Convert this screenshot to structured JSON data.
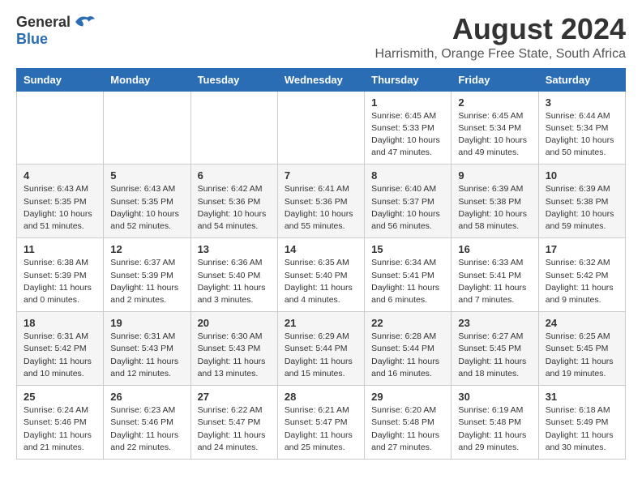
{
  "logo": {
    "general": "General",
    "blue": "Blue"
  },
  "title": "August 2024",
  "subtitle": "Harrismith, Orange Free State, South Africa",
  "days_of_week": [
    "Sunday",
    "Monday",
    "Tuesday",
    "Wednesday",
    "Thursday",
    "Friday",
    "Saturday"
  ],
  "weeks": [
    [
      {
        "day": "",
        "info": ""
      },
      {
        "day": "",
        "info": ""
      },
      {
        "day": "",
        "info": ""
      },
      {
        "day": "",
        "info": ""
      },
      {
        "day": "1",
        "info": "Sunrise: 6:45 AM\nSunset: 5:33 PM\nDaylight: 10 hours\nand 47 minutes."
      },
      {
        "day": "2",
        "info": "Sunrise: 6:45 AM\nSunset: 5:34 PM\nDaylight: 10 hours\nand 49 minutes."
      },
      {
        "day": "3",
        "info": "Sunrise: 6:44 AM\nSunset: 5:34 PM\nDaylight: 10 hours\nand 50 minutes."
      }
    ],
    [
      {
        "day": "4",
        "info": "Sunrise: 6:43 AM\nSunset: 5:35 PM\nDaylight: 10 hours\nand 51 minutes."
      },
      {
        "day": "5",
        "info": "Sunrise: 6:43 AM\nSunset: 5:35 PM\nDaylight: 10 hours\nand 52 minutes."
      },
      {
        "day": "6",
        "info": "Sunrise: 6:42 AM\nSunset: 5:36 PM\nDaylight: 10 hours\nand 54 minutes."
      },
      {
        "day": "7",
        "info": "Sunrise: 6:41 AM\nSunset: 5:36 PM\nDaylight: 10 hours\nand 55 minutes."
      },
      {
        "day": "8",
        "info": "Sunrise: 6:40 AM\nSunset: 5:37 PM\nDaylight: 10 hours\nand 56 minutes."
      },
      {
        "day": "9",
        "info": "Sunrise: 6:39 AM\nSunset: 5:38 PM\nDaylight: 10 hours\nand 58 minutes."
      },
      {
        "day": "10",
        "info": "Sunrise: 6:39 AM\nSunset: 5:38 PM\nDaylight: 10 hours\nand 59 minutes."
      }
    ],
    [
      {
        "day": "11",
        "info": "Sunrise: 6:38 AM\nSunset: 5:39 PM\nDaylight: 11 hours\nand 0 minutes."
      },
      {
        "day": "12",
        "info": "Sunrise: 6:37 AM\nSunset: 5:39 PM\nDaylight: 11 hours\nand 2 minutes."
      },
      {
        "day": "13",
        "info": "Sunrise: 6:36 AM\nSunset: 5:40 PM\nDaylight: 11 hours\nand 3 minutes."
      },
      {
        "day": "14",
        "info": "Sunrise: 6:35 AM\nSunset: 5:40 PM\nDaylight: 11 hours\nand 4 minutes."
      },
      {
        "day": "15",
        "info": "Sunrise: 6:34 AM\nSunset: 5:41 PM\nDaylight: 11 hours\nand 6 minutes."
      },
      {
        "day": "16",
        "info": "Sunrise: 6:33 AM\nSunset: 5:41 PM\nDaylight: 11 hours\nand 7 minutes."
      },
      {
        "day": "17",
        "info": "Sunrise: 6:32 AM\nSunset: 5:42 PM\nDaylight: 11 hours\nand 9 minutes."
      }
    ],
    [
      {
        "day": "18",
        "info": "Sunrise: 6:31 AM\nSunset: 5:42 PM\nDaylight: 11 hours\nand 10 minutes."
      },
      {
        "day": "19",
        "info": "Sunrise: 6:31 AM\nSunset: 5:43 PM\nDaylight: 11 hours\nand 12 minutes."
      },
      {
        "day": "20",
        "info": "Sunrise: 6:30 AM\nSunset: 5:43 PM\nDaylight: 11 hours\nand 13 minutes."
      },
      {
        "day": "21",
        "info": "Sunrise: 6:29 AM\nSunset: 5:44 PM\nDaylight: 11 hours\nand 15 minutes."
      },
      {
        "day": "22",
        "info": "Sunrise: 6:28 AM\nSunset: 5:44 PM\nDaylight: 11 hours\nand 16 minutes."
      },
      {
        "day": "23",
        "info": "Sunrise: 6:27 AM\nSunset: 5:45 PM\nDaylight: 11 hours\nand 18 minutes."
      },
      {
        "day": "24",
        "info": "Sunrise: 6:25 AM\nSunset: 5:45 PM\nDaylight: 11 hours\nand 19 minutes."
      }
    ],
    [
      {
        "day": "25",
        "info": "Sunrise: 6:24 AM\nSunset: 5:46 PM\nDaylight: 11 hours\nand 21 minutes."
      },
      {
        "day": "26",
        "info": "Sunrise: 6:23 AM\nSunset: 5:46 PM\nDaylight: 11 hours\nand 22 minutes."
      },
      {
        "day": "27",
        "info": "Sunrise: 6:22 AM\nSunset: 5:47 PM\nDaylight: 11 hours\nand 24 minutes."
      },
      {
        "day": "28",
        "info": "Sunrise: 6:21 AM\nSunset: 5:47 PM\nDaylight: 11 hours\nand 25 minutes."
      },
      {
        "day": "29",
        "info": "Sunrise: 6:20 AM\nSunset: 5:48 PM\nDaylight: 11 hours\nand 27 minutes."
      },
      {
        "day": "30",
        "info": "Sunrise: 6:19 AM\nSunset: 5:48 PM\nDaylight: 11 hours\nand 29 minutes."
      },
      {
        "day": "31",
        "info": "Sunrise: 6:18 AM\nSunset: 5:49 PM\nDaylight: 11 hours\nand 30 minutes."
      }
    ]
  ]
}
